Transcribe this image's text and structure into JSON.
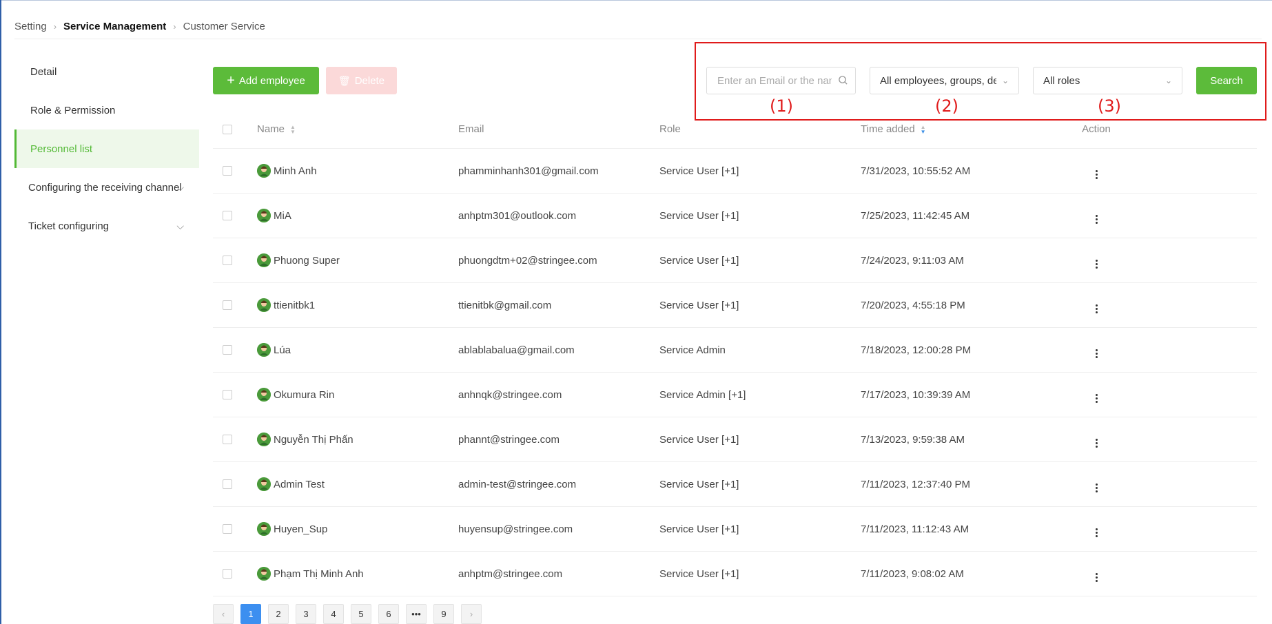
{
  "breadcrumb": {
    "item1": "Setting",
    "item2": "Service Management",
    "item3": "Customer Service"
  },
  "sidebar": {
    "detail": "Detail",
    "role_permission": "Role & Permission",
    "personnel_list": "Personnel list",
    "receiving_channel": "Configuring the receiving channel",
    "ticket_configuring": "Ticket configuring"
  },
  "toolbar": {
    "add_label": "Add employee",
    "delete_label": "Delete",
    "search_placeholder": "Enter an Email or the name",
    "group_filter": "All employees, groups, dep",
    "role_filter": "All roles",
    "search_label": "Search"
  },
  "annotations": {
    "a1": "(1)",
    "a2": "(2)",
    "a3": "(3)"
  },
  "table": {
    "headers": {
      "name": "Name",
      "email": "Email",
      "role": "Role",
      "time": "Time added",
      "action": "Action"
    },
    "rows": [
      {
        "name": "Minh Anh",
        "email": "phamminhanh301@gmail.com",
        "role": "Service User [+1]",
        "time": "7/31/2023, 10:55:52 AM"
      },
      {
        "name": "MiA",
        "email": "anhptm301@outlook.com",
        "role": "Service User [+1]",
        "time": "7/25/2023, 11:42:45 AM"
      },
      {
        "name": "Phuong Super",
        "email": "phuongdtm+02@stringee.com",
        "role": "Service User [+1]",
        "time": "7/24/2023, 9:11:03 AM"
      },
      {
        "name": "ttienitbk1",
        "email": "ttienitbk@gmail.com",
        "role": "Service User [+1]",
        "time": "7/20/2023, 4:55:18 PM"
      },
      {
        "name": "Lúa",
        "email": "ablablabalua@gmail.com",
        "role": "Service Admin",
        "time": "7/18/2023, 12:00:28 PM"
      },
      {
        "name": "Okumura Rin",
        "email": "anhnqk@stringee.com",
        "role": "Service Admin [+1]",
        "time": "7/17/2023, 10:39:39 AM"
      },
      {
        "name": "Nguyễn Thị Phấn",
        "email": "phannt@stringee.com",
        "role": "Service User [+1]",
        "time": "7/13/2023, 9:59:38 AM"
      },
      {
        "name": "Admin Test",
        "email": "admin-test@stringee.com",
        "role": "Service User [+1]",
        "time": "7/11/2023, 12:37:40 PM"
      },
      {
        "name": "Huyen_Sup",
        "email": "huyensup@stringee.com",
        "role": "Service User [+1]",
        "time": "7/11/2023, 11:12:43 AM"
      },
      {
        "name": "Phạm Thị Minh Anh",
        "email": "anhptm@stringee.com",
        "role": "Service User [+1]",
        "time": "7/11/2023, 9:08:02 AM"
      }
    ]
  },
  "pagination": {
    "prev": "‹",
    "next": "›",
    "ellipsis": "•••",
    "pages": [
      "1",
      "2",
      "3",
      "4",
      "5",
      "6",
      "9"
    ],
    "current": "1"
  },
  "colors": {
    "accent": "#5cbb3a",
    "highlight": "#e01b1b",
    "page_active": "#3c8ff0"
  }
}
